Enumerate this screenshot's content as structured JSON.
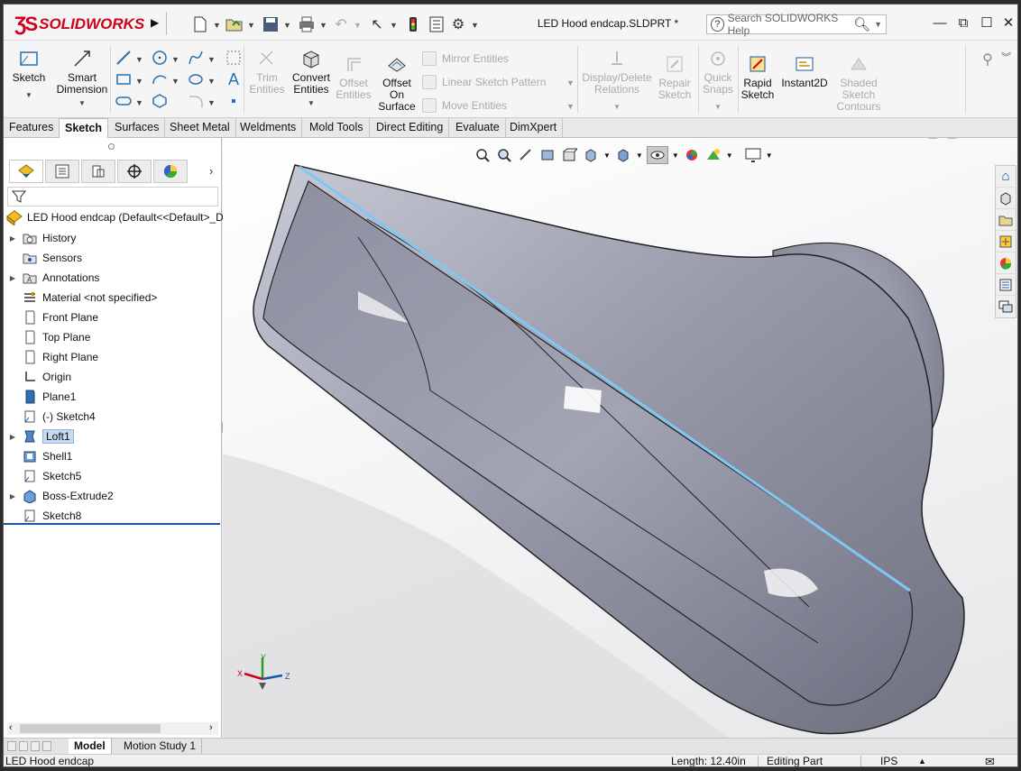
{
  "app": {
    "logo_text": "SOLIDWORKS",
    "document_title": "LED Hood endcap.SLDPRT *",
    "search_placeholder": "Search SOLIDWORKS Help"
  },
  "ribbon": {
    "sketch": "Sketch",
    "smart_dimension": [
      "Smart",
      "Dimension"
    ],
    "trim_entities": [
      "Trim",
      "Entities"
    ],
    "convert_entities": [
      "Convert",
      "Entities"
    ],
    "offset_entities": [
      "Offset",
      "Entities"
    ],
    "offset_on_surface": [
      "Offset",
      "On",
      "Surface"
    ],
    "mirror_entities": "Mirror Entities",
    "linear_sketch_pattern": "Linear Sketch Pattern",
    "move_entities": "Move Entities",
    "display_delete_relations": [
      "Display/Delete",
      "Relations"
    ],
    "repair_sketch": [
      "Repair",
      "Sketch"
    ],
    "quick_snaps": [
      "Quick",
      "Snaps"
    ],
    "rapid_sketch": [
      "Rapid",
      "Sketch"
    ],
    "instant2d": "Instant2D",
    "shaded_sketch_contours": [
      "Shaded",
      "Sketch",
      "Contours"
    ]
  },
  "tabs": [
    "Features",
    "Sketch",
    "Surfaces",
    "Sheet Metal",
    "Weldments",
    "Mold Tools",
    "Direct Editing",
    "Evaluate",
    "DimXpert"
  ],
  "active_tab": "Sketch",
  "tree": {
    "root": "LED Hood endcap  (Default<<Default>_D",
    "items": [
      {
        "label": "History",
        "icon": "history-folder-icon",
        "expandable": true
      },
      {
        "label": "Sensors",
        "icon": "sensors-icon",
        "expandable": false
      },
      {
        "label": "Annotations",
        "icon": "annotations-icon",
        "expandable": true
      },
      {
        "label": "Material <not specified>",
        "icon": "material-icon",
        "expandable": false
      },
      {
        "label": "Front Plane",
        "icon": "plane-icon",
        "expandable": false
      },
      {
        "label": "Top Plane",
        "icon": "plane-icon",
        "expandable": false
      },
      {
        "label": "Right Plane",
        "icon": "plane-icon",
        "expandable": false
      },
      {
        "label": "Origin",
        "icon": "origin-icon",
        "expandable": false
      },
      {
        "label": "Plane1",
        "icon": "plane-blue-icon",
        "expandable": false
      },
      {
        "label": "(-) Sketch4",
        "icon": "sketch-icon",
        "expandable": false
      },
      {
        "label": "Loft1",
        "icon": "loft-icon",
        "expandable": true,
        "selected": true
      },
      {
        "label": "Shell1",
        "icon": "shell-icon",
        "expandable": false
      },
      {
        "label": "Sketch5",
        "icon": "sketch-icon",
        "expandable": false
      },
      {
        "label": "Boss-Extrude2",
        "icon": "extrude-icon",
        "expandable": true
      },
      {
        "label": "Sketch8",
        "icon": "sketch-icon",
        "expandable": false
      }
    ]
  },
  "bottom_tabs": [
    "Model",
    "Motion Study 1"
  ],
  "status": {
    "name": "LED Hood endcap",
    "length": "Length: 12.40in",
    "mode": "Editing Part",
    "units": "IPS"
  },
  "triad": {
    "x": "X",
    "y": "Y",
    "z": "Z"
  },
  "colors": {
    "accent": "#1c56a3",
    "brand": "#d0021b",
    "model": "#9a9caa",
    "edge_highlight": "#7ec8f5"
  }
}
